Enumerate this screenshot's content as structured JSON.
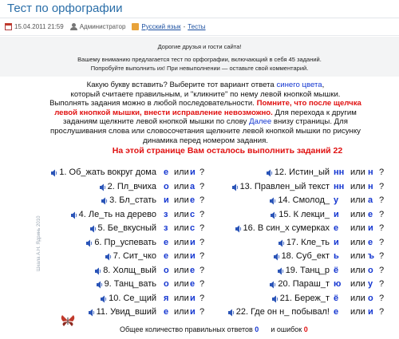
{
  "page": {
    "title": "Тест по орфографии",
    "date": "15.04.2011 21:59",
    "author": "Администратор",
    "category": "Русский язык",
    "category_sep": " - ",
    "section": "Тесты"
  },
  "intro": {
    "line1": "Дорогие друзья и гости сайта!",
    "line2": "Вашему вниманию предлагается тест по орфографии, включающий в себя 45 заданий.",
    "line3": "Попробуйте выполнить их! При невыполнении — оставьте свой комментарий."
  },
  "instructions": {
    "p1": "Какую букву вставить? Выберите тот вариант ответа ",
    "p1_blue": "синего цвета",
    "p2": ",",
    "p3": "который считаете правильным, и \"кликните\" по нему левой кнопкой мышки.",
    "p4": "Выполнять задания можно в любой последовательности. ",
    "p4_red": "Помните, что после щелчка левой кнопкой мышки, внести исправление невозможно.",
    "p5": " Для перехода к другим заданиям щелкните левой кнопкой мышки по слову ",
    "p5_blue": "Далее",
    "p6": " внизу страницы. Для прослушивания слова или словосочетания щелкните левой кнопкой мышки по рисунку динамика перед номером задания."
  },
  "remaining": "На этой странице Вам осталось выполнить заданий 22",
  "ili": "или",
  "qmark": "?",
  "questions_left": [
    {
      "text": "1. Об_жать вокруг дома",
      "a": "е",
      "b": "и"
    },
    {
      "text": "2. Пл_вчиха",
      "a": "о",
      "b": "а"
    },
    {
      "text": "3. Бл_стать",
      "a": "и",
      "b": "е"
    },
    {
      "text": "4. Ле_ть на дерево",
      "a": "з",
      "b": "с"
    },
    {
      "text": "5. Бе_вкусный",
      "a": "з",
      "b": "с"
    },
    {
      "text": "6. Пр_успевать",
      "a": "е",
      "b": "и"
    },
    {
      "text": "7. Сит_чко",
      "a": "е",
      "b": "и"
    },
    {
      "text": "8. Холщ_вый",
      "a": "о",
      "b": "е"
    },
    {
      "text": "9. Танц_вать",
      "a": "о",
      "b": "е"
    },
    {
      "text": "10. Се_щий",
      "a": "я",
      "b": "и"
    },
    {
      "text": "11. Увид_вший",
      "a": "е",
      "b": "и"
    }
  ],
  "questions_right": [
    {
      "text": "12. Истин_ый",
      "a": "нн",
      "b": "н"
    },
    {
      "text": "13. Правлен_ый текст",
      "a": "нн",
      "b": "н"
    },
    {
      "text": "14. Смолод_",
      "a": "у",
      "b": "а"
    },
    {
      "text": "15. К лекци_",
      "a": "и",
      "b": "е"
    },
    {
      "text": "16. В син_х сумерках",
      "a": "е",
      "b": "и"
    },
    {
      "text": "17. Кле_ть",
      "a": "и",
      "b": "е"
    },
    {
      "text": "18. Суб_ект",
      "a": "ь",
      "b": "ъ"
    },
    {
      "text": "19. Танц_р",
      "a": "ё",
      "b": "о"
    },
    {
      "text": "20. Параш_т",
      "a": "ю",
      "b": "у"
    },
    {
      "text": "21. Береж_т",
      "a": "ё",
      "b": "о"
    },
    {
      "text": "22. Где он н_ побывал!",
      "a": "е",
      "b": "и"
    }
  ],
  "footer": {
    "label_correct": "Общее количество правильных ответов ",
    "correct": "0",
    "label_errors": "и ошибок",
    "errors": "0"
  },
  "vertical_note": "Шкала А.Н. Ядринь 2010",
  "colors": {
    "title": "#2a6ea8",
    "option_blue": "#1537d1",
    "warning_red": "#e01010"
  }
}
